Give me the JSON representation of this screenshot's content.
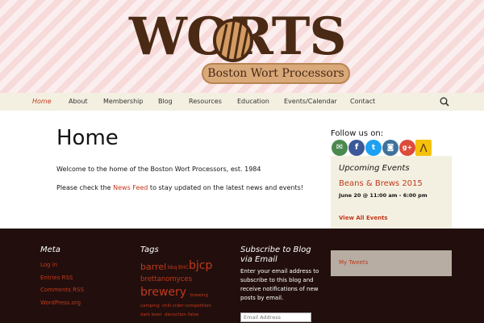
{
  "header": {
    "logo_word": "WORTS",
    "logo_tagline": "Boston Wort Processors"
  },
  "nav": {
    "items": [
      "Home",
      "About",
      "Membership",
      "Blog",
      "Resources",
      "Education",
      "Events/Calendar",
      "Contact"
    ],
    "active": "Home"
  },
  "main": {
    "title": "Home",
    "intro": "Welcome to the home of the Boston Wort Processors, est. 1984",
    "news_prefix": "Please check the ",
    "news_link": "News Feed",
    "news_suffix": " to stay updated on the latest news and events!"
  },
  "sidebar": {
    "follow_title": "Follow us on:",
    "social_icons": [
      "email-icon",
      "facebook-icon",
      "twitter-icon",
      "instagram-icon",
      "google-plus-icon",
      "untappd-icon"
    ],
    "events_title": "Upcoming Events",
    "event_name": "Beans & Brews 2015",
    "event_date": "June 20 @ 11:00 am - 6:00 pm",
    "view_all": "View All Events"
  },
  "footer": {
    "meta": {
      "heading": "Meta",
      "links": [
        "Log in",
        "Entries RSS",
        "Comments RSS",
        "WordPress.org"
      ]
    },
    "tags": {
      "heading": "Tags",
      "items": [
        "barrel",
        "bbq",
        "BHC",
        "bjcp",
        "brettanomyces",
        "brewery",
        "brewing",
        "camping",
        "chili",
        "cider",
        "competition",
        "dark beer",
        "decoction",
        "false"
      ]
    },
    "subscribe": {
      "heading_line1": "Subscribe to Blog",
      "heading_line2": "via Email",
      "text": "Enter your email address to subscribe to this blog and receive notifications of new posts by email.",
      "placeholder": "Email Address"
    },
    "tweets": "My Tweets"
  },
  "colors": {
    "accent": "#c0391b",
    "footer_bg": "#220f0d",
    "nav_bg": "#f3f0e1",
    "logo_brown": "#4a2a14"
  }
}
